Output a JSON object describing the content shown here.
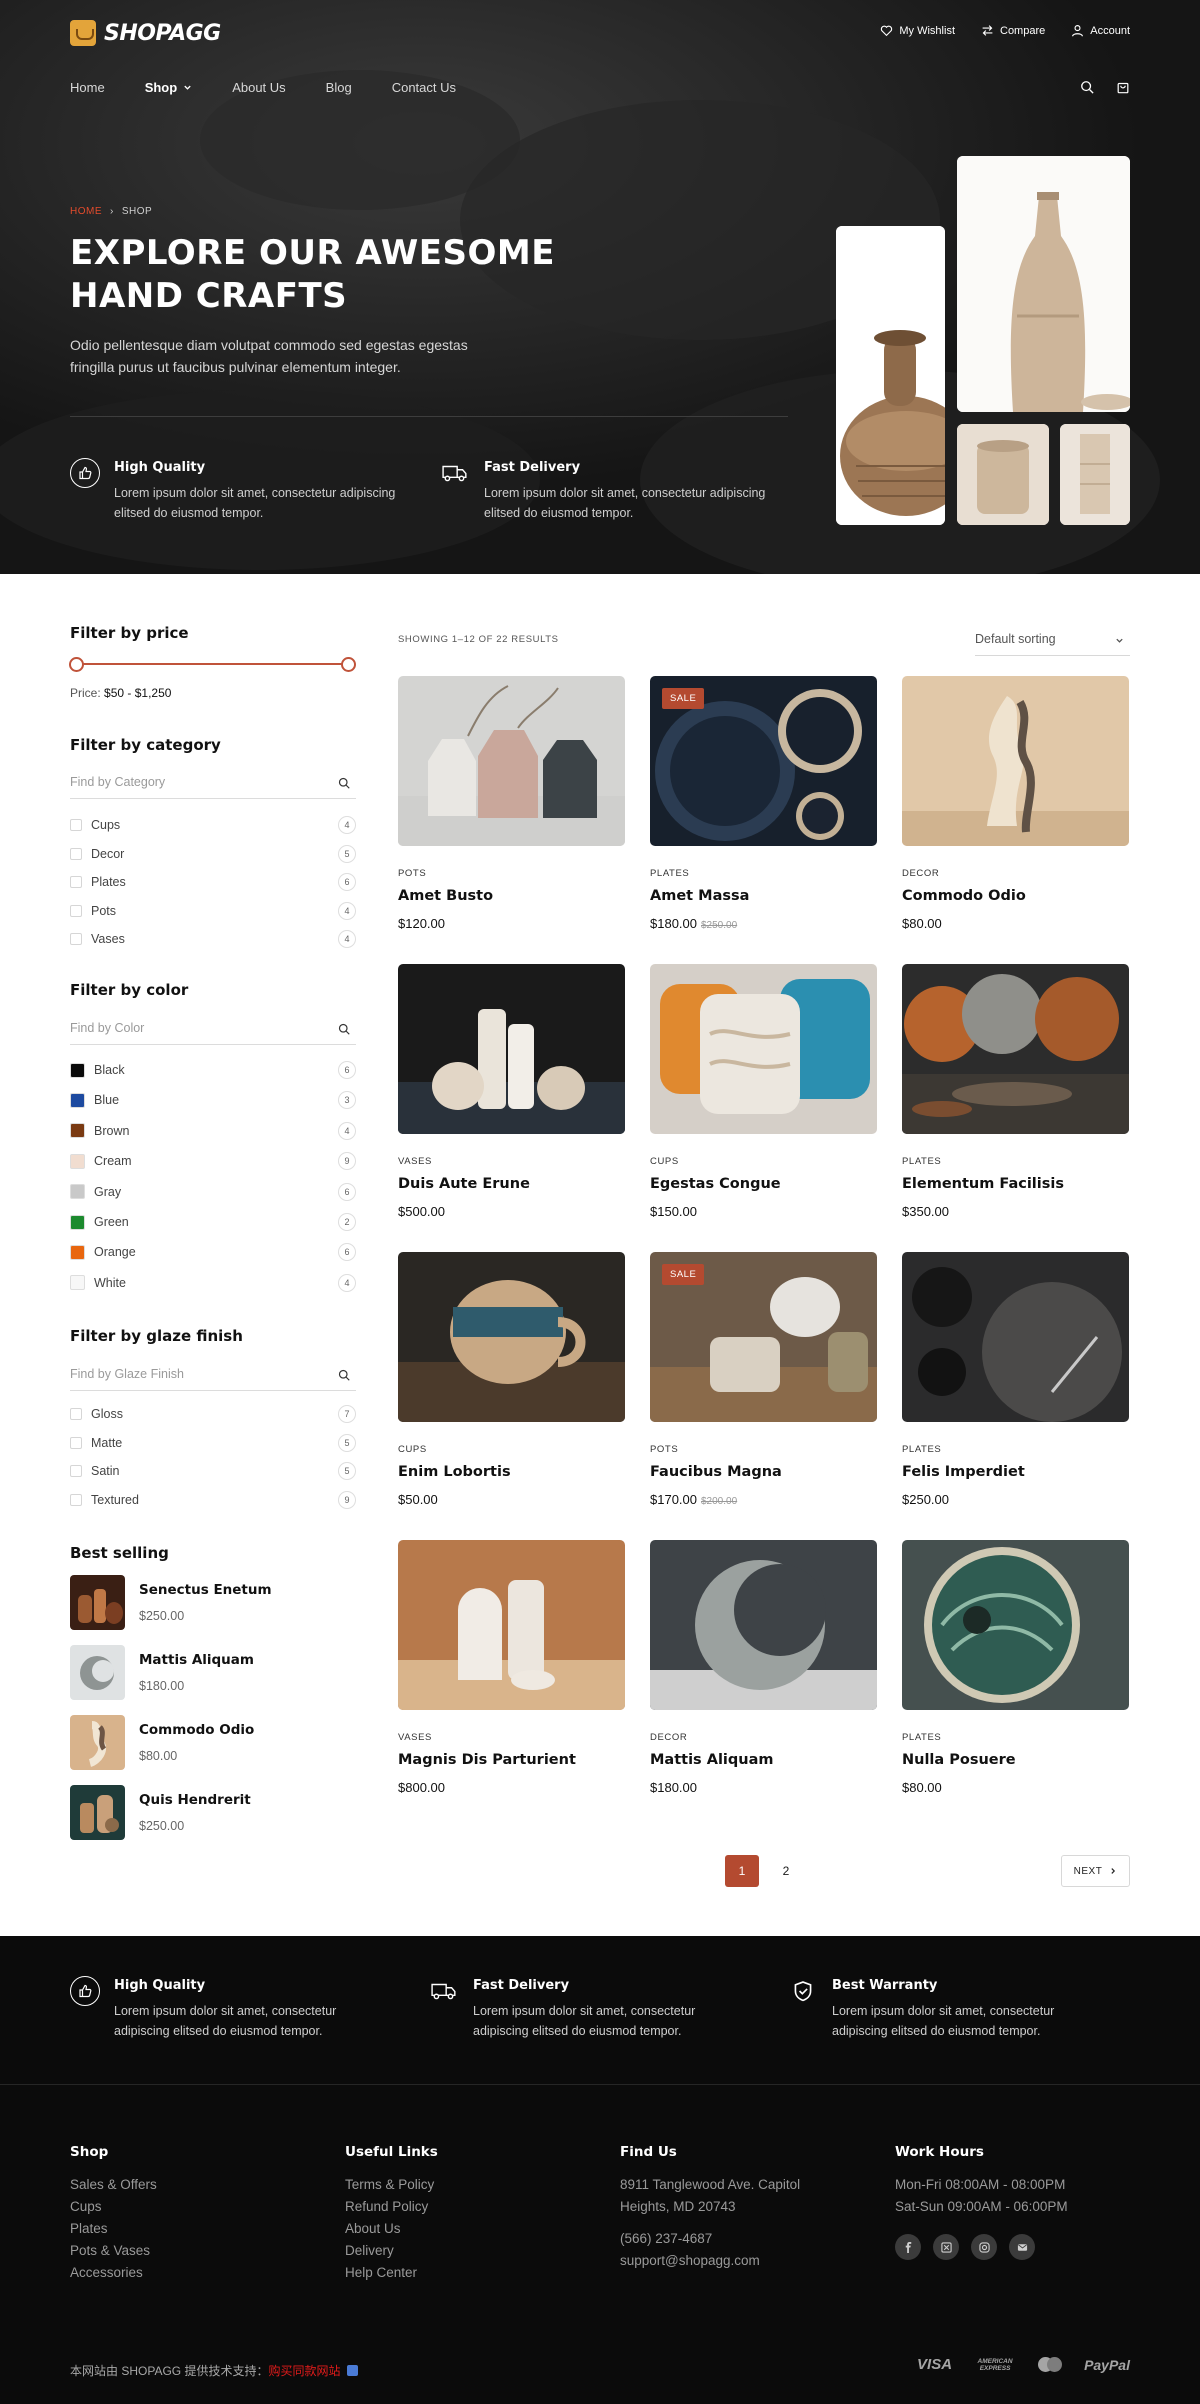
{
  "brand": {
    "name": "SHOPAGG"
  },
  "topbar": {
    "wishlist": "My Wishlist",
    "compare": "Compare",
    "account": "Account"
  },
  "nav": {
    "items": [
      "Home",
      "Shop",
      "About Us",
      "Blog",
      "Contact Us"
    ]
  },
  "hero": {
    "breadcrumb_home": "HOME",
    "breadcrumb_current": "SHOP",
    "title": "EXPLORE OUR AWESOME HAND CRAFTS",
    "description": "Odio pellentesque diam volutpat commodo sed egestas egestas fringilla purus ut faucibus pulvinar elementum integer.",
    "features": [
      {
        "title": "High Quality",
        "text": "Lorem ipsum dolor sit amet, consectetur adipiscing elitsed do eiusmod tempor.",
        "icon": "thumbs-up-icon"
      },
      {
        "title": "Fast Delivery",
        "text": "Lorem ipsum dolor sit amet, consectetur adipiscing elitsed do eiusmod tempor.",
        "icon": "truck-icon"
      }
    ]
  },
  "filters": {
    "price": {
      "title": "Filter by price",
      "label": "Price:",
      "range": "$50 - $1,250"
    },
    "category": {
      "title": "Filter by category",
      "placeholder": "Find by Category",
      "items": [
        {
          "label": "Cups",
          "count": "4"
        },
        {
          "label": "Decor",
          "count": "5"
        },
        {
          "label": "Plates",
          "count": "6"
        },
        {
          "label": "Pots",
          "count": "4"
        },
        {
          "label": "Vases",
          "count": "4"
        }
      ]
    },
    "color": {
      "title": "Filter by color",
      "placeholder": "Find by Color",
      "items": [
        {
          "label": "Black",
          "count": "6",
          "swatch": "#0a0a0a"
        },
        {
          "label": "Blue",
          "count": "3",
          "swatch": "#1d4aa0"
        },
        {
          "label": "Brown",
          "count": "4",
          "swatch": "#7a3a12"
        },
        {
          "label": "Cream",
          "count": "9",
          "swatch": "#f1ddd0"
        },
        {
          "label": "Gray",
          "count": "6",
          "swatch": "#c9c9c9"
        },
        {
          "label": "Green",
          "count": "2",
          "swatch": "#1c8a2e"
        },
        {
          "label": "Orange",
          "count": "6",
          "swatch": "#e8660f"
        },
        {
          "label": "White",
          "count": "4",
          "swatch": "#f7f7f7"
        }
      ]
    },
    "glaze": {
      "title": "Filter by glaze finish",
      "placeholder": "Find by Glaze Finish",
      "items": [
        {
          "label": "Gloss",
          "count": "7"
        },
        {
          "label": "Matte",
          "count": "5"
        },
        {
          "label": "Satin",
          "count": "5"
        },
        {
          "label": "Textured",
          "count": "9"
        }
      ]
    }
  },
  "best_selling": {
    "title": "Best selling",
    "items": [
      {
        "name": "Senectus Enetum",
        "price": "$250.00"
      },
      {
        "name": "Mattis Aliquam",
        "price": "$180.00"
      },
      {
        "name": "Commodo Odio",
        "price": "$80.00"
      },
      {
        "name": "Quis Hendrerit",
        "price": "$250.00"
      }
    ]
  },
  "listing": {
    "results": "SHOWING 1–12 OF 22 RESULTS",
    "sorting": "Default sorting",
    "sale_label": "SALE",
    "products": [
      {
        "category": "POTS",
        "name": "Amet Busto",
        "price": "$120.00",
        "old_price": ""
      },
      {
        "category": "PLATES",
        "name": "Amet Massa",
        "price": "$180.00",
        "old_price": "$250.00"
      },
      {
        "category": "DECOR",
        "name": "Commodo Odio",
        "price": "$80.00",
        "old_price": ""
      },
      {
        "category": "VASES",
        "name": "Duis Aute Erune",
        "price": "$500.00",
        "old_price": ""
      },
      {
        "category": "CUPS",
        "name": "Egestas Congue",
        "price": "$150.00",
        "old_price": ""
      },
      {
        "category": "PLATES",
        "name": "Elementum Facilisis",
        "price": "$350.00",
        "old_price": ""
      },
      {
        "category": "CUPS",
        "name": "Enim Lobortis",
        "price": "$50.00",
        "old_price": ""
      },
      {
        "category": "POTS",
        "name": "Faucibus Magna",
        "price": "$170.00",
        "old_price": "$200.00"
      },
      {
        "category": "PLATES",
        "name": "Felis Imperdiet",
        "price": "$250.00",
        "old_price": ""
      },
      {
        "category": "VASES",
        "name": "Magnis Dis Parturient",
        "price": "$800.00",
        "old_price": ""
      },
      {
        "category": "DECOR",
        "name": "Mattis Aliquam",
        "price": "$180.00",
        "old_price": ""
      },
      {
        "category": "PLATES",
        "name": "Nulla Posuere",
        "price": "$80.00",
        "old_price": ""
      }
    ],
    "pagination": {
      "pages": [
        "1",
        "2"
      ],
      "next": "NEXT"
    }
  },
  "footer": {
    "features": [
      {
        "title": "High Quality",
        "text": "Lorem ipsum dolor sit amet, consectetur adipiscing elitsed do eiusmod tempor."
      },
      {
        "title": "Fast Delivery",
        "text": "Lorem ipsum dolor sit amet, consectetur adipiscing elitsed do eiusmod tempor."
      },
      {
        "title": "Best Warranty",
        "text": "Lorem ipsum dolor sit amet, consectetur adipiscing elitsed do eiusmod tempor."
      }
    ],
    "columns": {
      "shop": {
        "title": "Shop",
        "links": [
          "Sales & Offers",
          "Cups",
          "Plates",
          "Pots & Vases",
          "Accessories"
        ]
      },
      "useful": {
        "title": "Useful Links",
        "links": [
          "Terms & Policy",
          "Refund Policy",
          "About Us",
          "Delivery",
          "Help Center"
        ]
      },
      "find": {
        "title": "Find Us",
        "address": "8911 Tanglewood Ave. Capitol Heights, MD 20743",
        "phone": "(566) 237-4687",
        "email": "support@shopagg.com"
      },
      "hours": {
        "title": "Work Hours",
        "lines": [
          "Mon-Fri 08:00AM - 08:00PM",
          "Sat-Sun 09:00AM - 06:00PM"
        ]
      }
    },
    "copyright": "本网站由 SHOPAGG 提供技术支持：",
    "copyright_link": "购买同款网站",
    "payments": [
      "VISA",
      "AMERICAN EXPRESS",
      "Mastercard",
      "PayPal"
    ]
  }
}
